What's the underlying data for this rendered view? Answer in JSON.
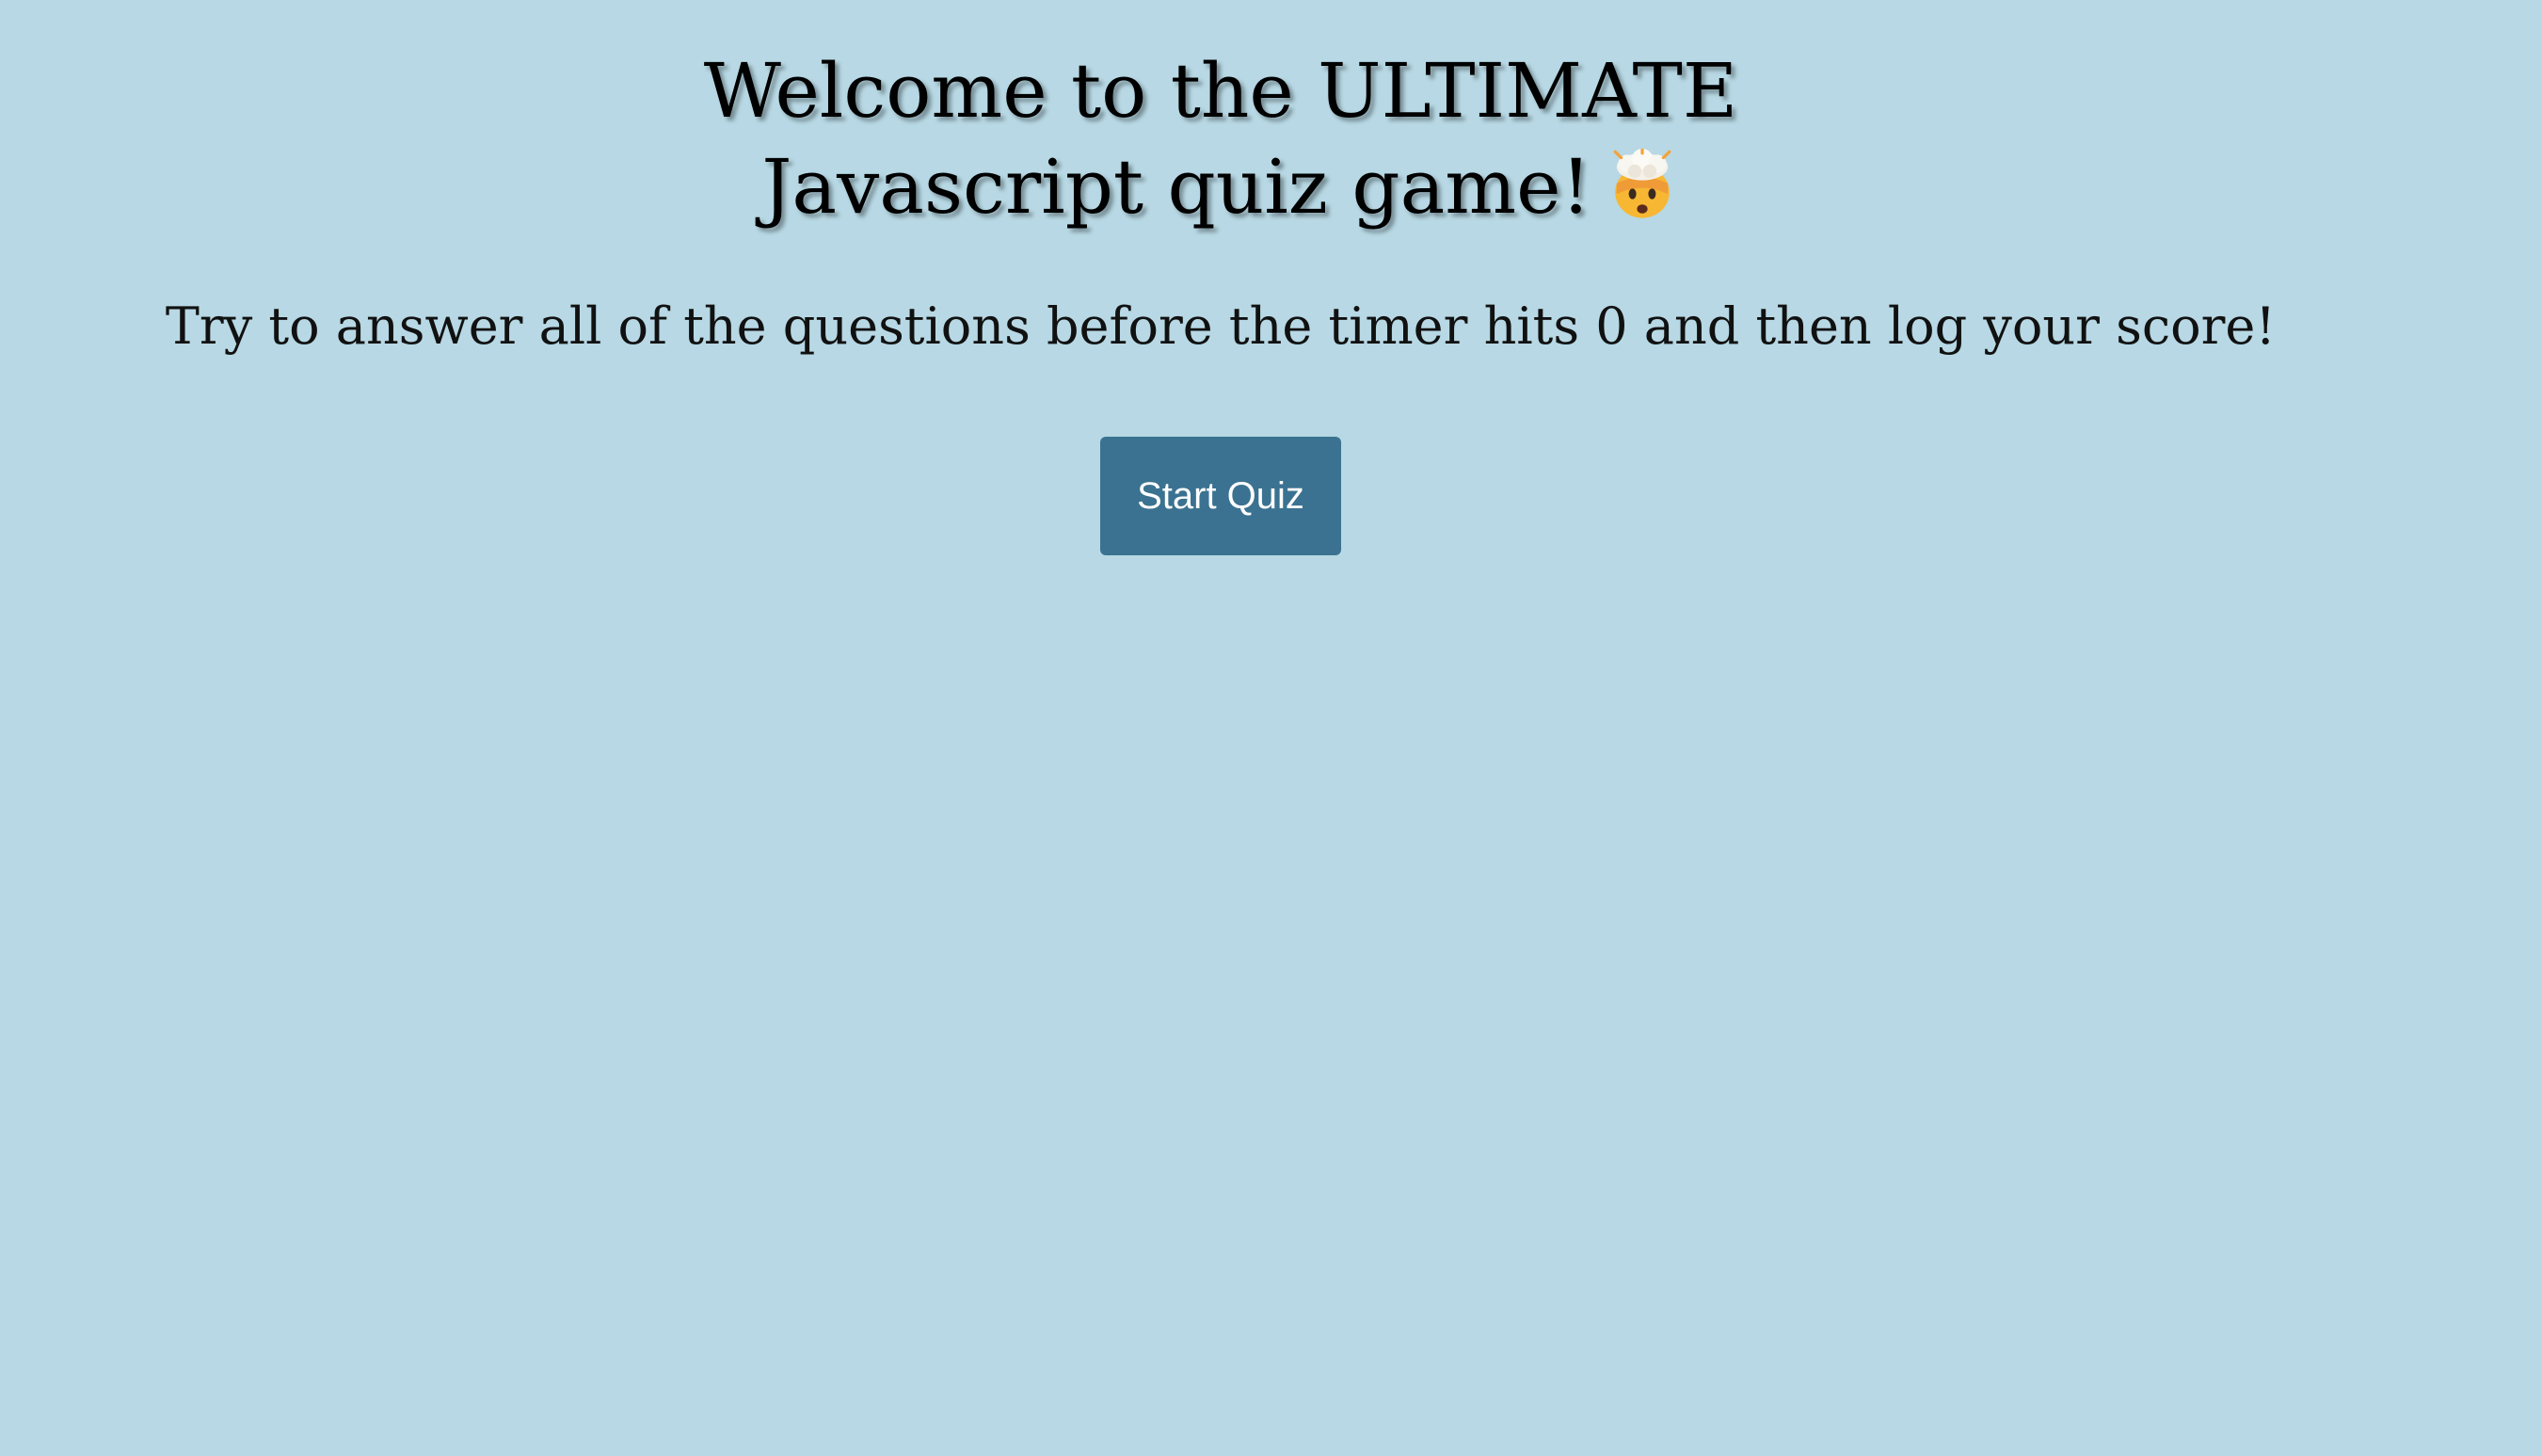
{
  "page": {
    "title_line1": "Welcome to the ULTIMATE",
    "title_line2": "Javascript quiz game!",
    "title_icon": "exploding-head-emoji",
    "subtitle": "Try to answer all of the questions before the timer hits 0 and then log your score!",
    "start_button_label": "Start Quiz"
  },
  "colors": {
    "background": "#b7d8e4",
    "button": "#3b7291",
    "button_text": "#ffffff"
  }
}
